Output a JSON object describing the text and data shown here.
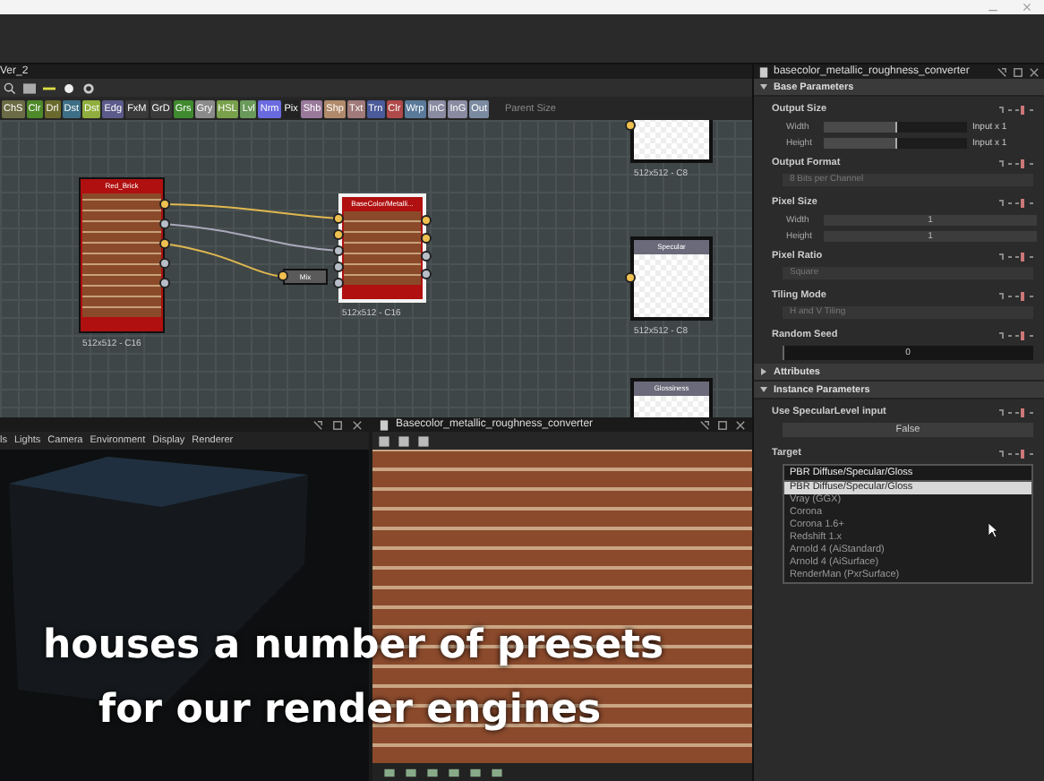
{
  "graph": {
    "tab": "Ver_2",
    "parent_size": "Parent Size",
    "filters": [
      {
        "label": "ChS",
        "color": "#6b6b45"
      },
      {
        "label": "Clr",
        "color": "#4f8a2a"
      },
      {
        "label": "Drl",
        "color": "#6b6a2e"
      },
      {
        "label": "Dst",
        "color": "#3d6f86"
      },
      {
        "label": "Dst",
        "color": "#8fae3e"
      },
      {
        "label": "Edg",
        "color": "#5c5a8a"
      },
      {
        "label": "FxM",
        "color": "#3a3a3a"
      },
      {
        "label": "GrD",
        "color": "#3a3a3a"
      },
      {
        "label": "Grs",
        "color": "#3f8a2e"
      },
      {
        "label": "Gry",
        "color": "#8a8a8a"
      },
      {
        "label": "HSL",
        "color": "#79a04a"
      },
      {
        "label": "Lvl",
        "color": "#6a9a5a"
      },
      {
        "label": "Nrm",
        "color": "#6a6ae0"
      },
      {
        "label": "Pix",
        "color": "#222222"
      },
      {
        "label": "Shb",
        "color": "#9a7a9a"
      },
      {
        "label": "Shp",
        "color": "#b08a6a"
      },
      {
        "label": "Txt",
        "color": "#a07a7a"
      },
      {
        "label": "Trn",
        "color": "#4a5a9a"
      },
      {
        "label": "Clr",
        "color": "#b04a4a"
      },
      {
        "label": "Wrp",
        "color": "#5a7a9a"
      },
      {
        "label": "InC",
        "color": "#8a8aa0"
      },
      {
        "label": "InG",
        "color": "#8a8aa0"
      },
      {
        "label": "Out",
        "color": "#7a8aa0"
      }
    ],
    "nodes": [
      {
        "title": "Red_Brick",
        "kind": "texture",
        "footer": "512x512 - C16",
        "selected": false
      },
      {
        "title": "BaseColor/Metalli...",
        "kind": "texture",
        "footer": "512x512 - C16",
        "selected": true
      },
      {
        "title": "Mix",
        "kind": "small",
        "selected": false
      },
      {
        "kind": "output",
        "footer": "512x512 - C8",
        "selected": false
      },
      {
        "title": "Specular",
        "kind": "output",
        "footer": "512x512 - C8",
        "selected": false
      },
      {
        "title": "Glossiness",
        "kind": "output",
        "selected": false
      }
    ]
  },
  "viewport_3d": {
    "menu": [
      "ls",
      "Lights",
      "Camera",
      "Environment",
      "Display",
      "Renderer"
    ]
  },
  "viewport_2d": {
    "title": "Basecolor_metallic_roughness_converter"
  },
  "properties": {
    "title": "basecolor_metallic_roughness_converter",
    "sections": [
      {
        "title": "Base Parameters",
        "expanded": true,
        "params": [
          {
            "label": "Output Size",
            "kind": "size",
            "rows": [
              {
                "label": "Width",
                "value": "Input x 1",
                "level": 0.5
              },
              {
                "label": "Height",
                "value": "Input x 1",
                "level": 0.5
              }
            ]
          },
          {
            "label": "Output Format",
            "kind": "field",
            "value": "8 Bits per Channel"
          },
          {
            "label": "Pixel Size",
            "kind": "pair",
            "rows": [
              {
                "label": "Width",
                "value": "1"
              },
              {
                "label": "Height",
                "value": "1"
              }
            ]
          },
          {
            "label": "Pixel Ratio",
            "kind": "field",
            "value": "Square"
          },
          {
            "label": "Tiling Mode",
            "kind": "field",
            "value": "H and V Tiling"
          },
          {
            "label": "Random Seed",
            "kind": "slider",
            "value": "0",
            "level": 0
          }
        ]
      },
      {
        "title": "Attributes",
        "expanded": false
      },
      {
        "title": "Instance Parameters",
        "expanded": true,
        "params": [
          {
            "label": "Use SpecularLevel input",
            "kind": "button",
            "value": "False"
          },
          {
            "label": "Target",
            "kind": "dropdown",
            "value": "PBR Diffuse/Specular/Gloss",
            "options": [
              {
                "label": "PBR Diffuse/Specular/Gloss",
                "selected": true
              },
              {
                "label": "Vray (GGX)",
                "selected": false
              },
              {
                "label": "Corona",
                "selected": false
              },
              {
                "label": "Corona 1.6+",
                "selected": false
              },
              {
                "label": "Redshift 1.x",
                "selected": false
              },
              {
                "label": "Arnold 4 (AiStandard)",
                "selected": false
              },
              {
                "label": "Arnold 4 (AiSurface)",
                "selected": false
              },
              {
                "label": "RenderMan (PxrSurface)",
                "selected": false
              }
            ]
          }
        ]
      }
    ]
  },
  "caption": [
    "houses a number of presets",
    "for our render engines"
  ]
}
